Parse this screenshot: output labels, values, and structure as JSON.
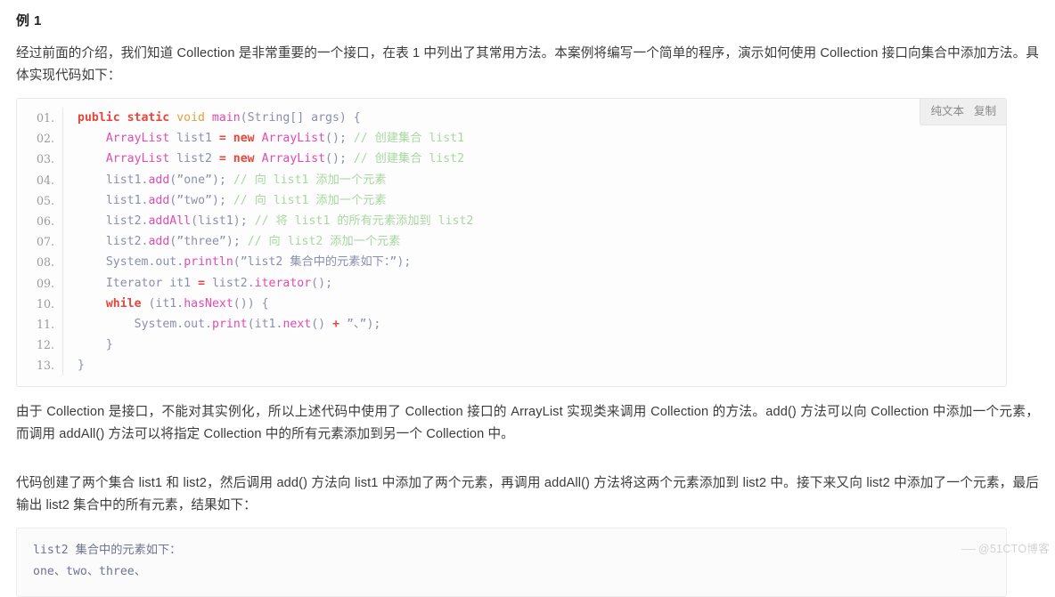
{
  "page": {
    "heading": "例 1",
    "intro_paragraph": "经过前面的介绍，我们知道 Collection 是非常重要的一个接口，在表 1 中列出了其常用方法。本案例将编写一个简单的程序，演示如何使用 Collection 接口向集合中添加方法。具体实现代码如下：",
    "explain_paragraph": "由于 Collection 是接口，不能对其实例化，所以上述代码中使用了 Collection 接口的 ArrayList 实现类来调用 Collection 的方法。add() 方法可以向 Collection 中添加一个元素，而调用 addAll() 方法可以将指定 Collection 中的所有元素添加到另一个 Collection 中。",
    "result_paragraph": "代码创建了两个集合 list1 和 list2，然后调用 add() 方法向 list1 中添加了两个元素，再调用 addAll() 方法将这两个元素添加到 list2 中。接下来又向 list2 中添加了一个元素，最后输出 list2 集合中的所有元素，结果如下："
  },
  "code_block": {
    "actions": {
      "plain_text_label": "纯文本",
      "copy_label": "复制"
    },
    "language": "java",
    "line_numbers": [
      "01.",
      "02.",
      "03.",
      "04.",
      "05.",
      "06.",
      "07.",
      "08.",
      "09.",
      "10.",
      "11.",
      "12.",
      "13."
    ],
    "lines": [
      {
        "n": "01.",
        "text": "public static void main(String[] args) {"
      },
      {
        "n": "02.",
        "text": "    ArrayList list1 = new ArrayList(); // 创建集合 list1"
      },
      {
        "n": "03.",
        "text": "    ArrayList list2 = new ArrayList(); // 创建集合 list2"
      },
      {
        "n": "04.",
        "text": "    list1.add(\"one\"); // 向 list1 添加一个元素"
      },
      {
        "n": "05.",
        "text": "    list1.add(\"two\"); // 向 list1 添加一个元素"
      },
      {
        "n": "06.",
        "text": "    list2.addAll(list1); // 将 list1 的所有元素添加到 list2"
      },
      {
        "n": "07.",
        "text": "    list2.add(\"three\"); // 向 list2 添加一个元素"
      },
      {
        "n": "08.",
        "text": "    System.out.println(\"list2 集合中的元素如下：\");"
      },
      {
        "n": "09.",
        "text": "    Iterator it1 = list2.iterator();"
      },
      {
        "n": "10.",
        "text": "    while (it1.hasNext()) {"
      },
      {
        "n": "11.",
        "text": "        System.out.print(it1.next() + \"、\");"
      },
      {
        "n": "12.",
        "text": "    }"
      },
      {
        "n": "13.",
        "text": "}"
      }
    ]
  },
  "output_block": {
    "lines": [
      "list2 集合中的元素如下：",
      "one、two、three、"
    ]
  },
  "watermark": {
    "text": "@51CTO博客"
  },
  "colors": {
    "keyword": "#e8453c",
    "type": "#d9a441",
    "function": "#e24bb0",
    "comment": "#a8d8a0",
    "plain": "#8a8fae",
    "line_number": "#9a9a9a",
    "code_background": "#fdfdfd",
    "output_background": "#fbfbfb",
    "body_text": "#3b3b3b",
    "watermark": "#d3d3d3"
  }
}
